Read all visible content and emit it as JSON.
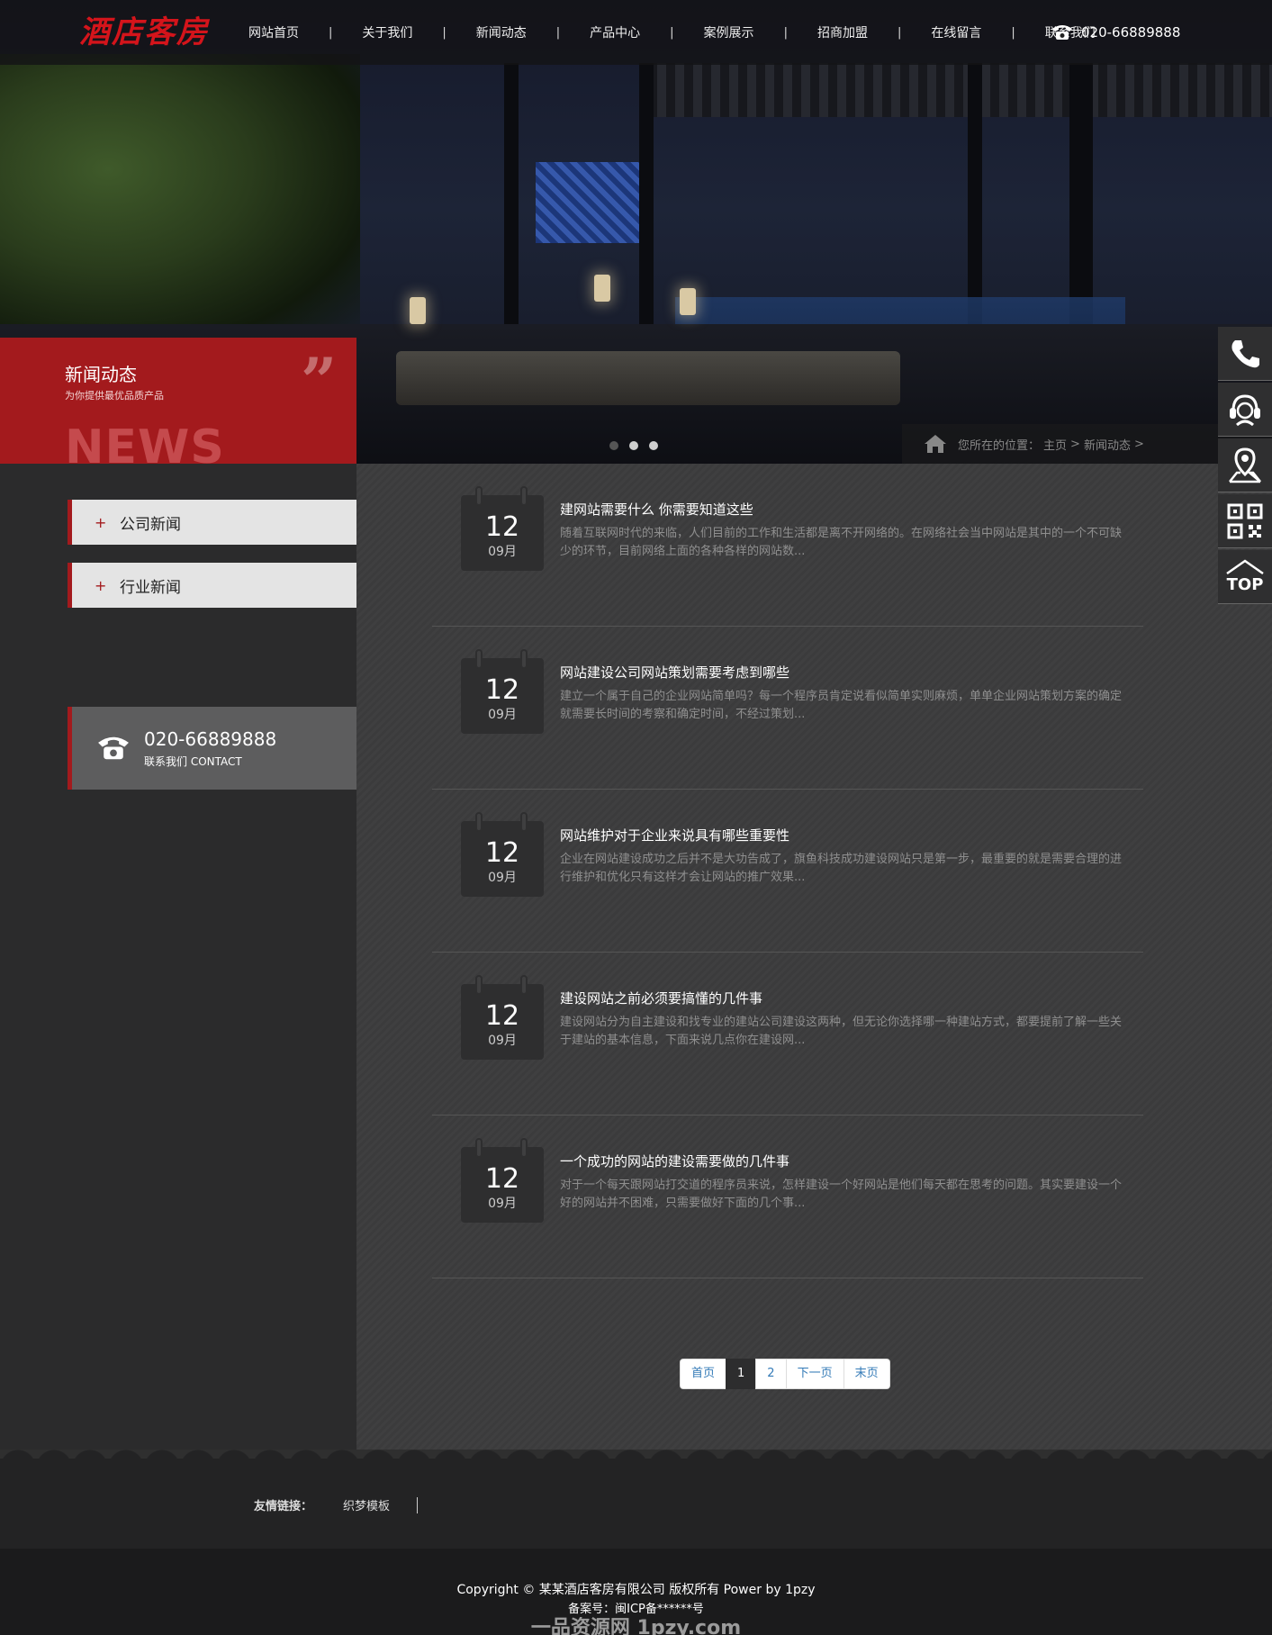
{
  "header": {
    "logo": "酒店客房",
    "nav": [
      "网站首页",
      "关于我们",
      "新闻动态",
      "产品中心",
      "案例展示",
      "招商加盟",
      "在线留言",
      "联系我们"
    ],
    "nav_separator": "|",
    "phone": "020-66889888"
  },
  "banner": {
    "category_title": "新闻动态",
    "category_subtitle": "为你提供最优品质产品",
    "category_en": "NEWS",
    "quote_mark": "”",
    "breadcrumb": {
      "prefix": "您所在的位置：",
      "home": "主页",
      "sep": ">",
      "current": "新闻动态",
      "tail": ">"
    }
  },
  "sidebar": {
    "menu": [
      {
        "icon": "+",
        "label": "公司新闻"
      },
      {
        "icon": "+",
        "label": "行业新闻"
      }
    ],
    "contact": {
      "phone": "020-66889888",
      "label": "联系我们 CONTACT"
    }
  },
  "news": [
    {
      "day": "12",
      "month": "09月",
      "title": "建网站需要什么 你需要知道这些",
      "desc": "随着互联网时代的来临，人们目前的工作和生活都是离不开网络的。在网络社会当中网站是其中的一个不可缺少的环节，目前网络上面的各种各样的网站数..."
    },
    {
      "day": "12",
      "month": "09月",
      "title": "网站建设公司网站策划需要考虑到哪些",
      "desc": "建立一个属于自己的企业网站简单吗？每一个程序员肯定说看似简单实则麻烦，单单企业网站策划方案的确定就需要长时间的考察和确定时间，不经过策划..."
    },
    {
      "day": "12",
      "month": "09月",
      "title": "网站维护对于企业来说具有哪些重要性",
      "desc": "企业在网站建设成功之后并不是大功告成了，旗鱼科技成功建设网站只是第一步，最重要的就是需要合理的进行维护和优化只有这样才会让网站的推广效果..."
    },
    {
      "day": "12",
      "month": "09月",
      "title": "建设网站之前必须要搞懂的几件事",
      "desc": "建设网站分为自主建设和找专业的建站公司建设这两种，但无论你选择哪一种建站方式，都要提前了解一些关于建站的基本信息，下面来说几点你在建设网..."
    },
    {
      "day": "12",
      "month": "09月",
      "title": "一个成功的网站的建设需要做的几件事",
      "desc": "对于一个每天跟网站打交道的程序员来说，怎样建设一个好网站是他们每天都在思考的问题。其实要建设一个好的网站并不困难，只需要做好下面的几个事..."
    }
  ],
  "pagination": {
    "first": "首页",
    "pages": [
      "1",
      "2"
    ],
    "active": "1",
    "next": "下一页",
    "last": "末页"
  },
  "footer": {
    "friend_label": "友情链接：",
    "friend_links": [
      "织梦模板"
    ],
    "copyright": "Copyright © 某某酒店客房有限公司 版权所有 Power by 1pzy",
    "icp": "备案号：闽ICP备******号",
    "watermark": "一品资源网 1pzy.com"
  },
  "side_tools": {
    "icons": [
      "phone-icon",
      "customer-service-icon",
      "location-icon",
      "qrcode-icon",
      "back-to-top-icon"
    ],
    "top_label": "TOP"
  },
  "colors": {
    "accent_red": "#a31a1d",
    "logo_red": "#d4141b",
    "link_blue": "#337ab7"
  }
}
